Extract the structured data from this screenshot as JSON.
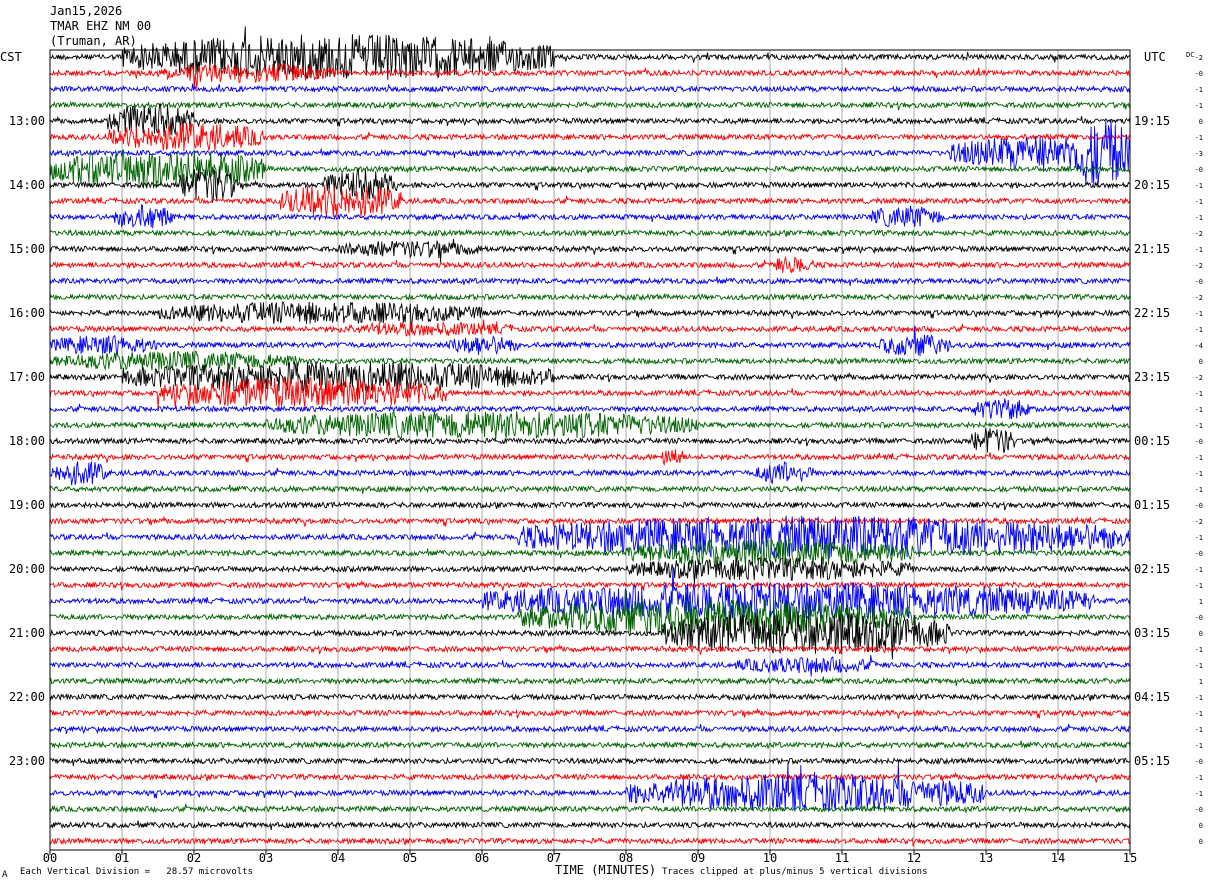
{
  "header": {
    "date": "Jan15,2026",
    "station": "TMAR EHZ NM 00",
    "location": "(Truman, AR)"
  },
  "left_tz": "CST",
  "right_tz": "UTC",
  "dc_label": "DC",
  "footer": {
    "vertical_division": "Each Vertical Division =   28.57 microvolts",
    "xlabel": "TIME (MINUTES)",
    "clip_note": "Traces clipped at plus/minus 5 vertical divisions",
    "corner_mark": "A"
  },
  "colors": {
    "trace_cycle": [
      "#000000",
      "#ff0000",
      "#0000ff",
      "#006400"
    ],
    "grid": "#a9a9a9",
    "frame": "#000000"
  },
  "chart_data": {
    "type": "line",
    "title": "",
    "xlabel": "TIME (MINUTES)",
    "xlim": [
      0,
      15
    ],
    "x_ticks": [
      "00",
      "01",
      "02",
      "03",
      "04",
      "05",
      "06",
      "07",
      "08",
      "09",
      "10",
      "11",
      "12",
      "13",
      "14",
      "15"
    ],
    "rows_per_hour": 4,
    "start_local_hour": "12:00",
    "left_time_labels": [
      "13:00",
      "14:00",
      "15:00",
      "16:00",
      "17:00",
      "18:00",
      "19:00",
      "20:00",
      "21:00",
      "22:00",
      "23:00"
    ],
    "right_time_labels": [
      "19:15",
      "20:15",
      "21:15",
      "22:15",
      "23:15",
      "00:15",
      "01:15",
      "02:15",
      "03:15",
      "04:15",
      "05:15"
    ],
    "dc_offsets": [
      "-2",
      "-0",
      "-1",
      "-1",
      "0",
      "-1",
      "-3",
      "-0",
      "-1",
      "-1",
      "-1",
      "-2",
      "-1",
      "-2",
      "-0",
      "-2",
      "-1",
      "-1",
      "-4",
      "0",
      "-2",
      "-1",
      "-1",
      "-1",
      "-0",
      "-1",
      "-1",
      "-1",
      "-0",
      "-2",
      "-1",
      "-0",
      "-1",
      "-1",
      "1",
      "-0",
      "0",
      "-1",
      "-1",
      "1",
      "-1",
      "-1",
      "-1",
      "-1",
      "-0",
      "-1",
      "-1",
      "-0",
      "0",
      "0"
    ],
    "activity": {
      "description": "helicorder seismogram, each row = 15 minutes",
      "bursts": [
        {
          "row": 0,
          "x_start": 1.0,
          "x_end": 7.0,
          "amp": 1.6
        },
        {
          "row": 1,
          "x_start": 1.5,
          "x_end": 4.0,
          "amp": 0.7
        },
        {
          "row": 4,
          "x_start": 0.8,
          "x_end": 2.0,
          "amp": 1.2
        },
        {
          "row": 5,
          "x_start": 0.8,
          "x_end": 3.0,
          "amp": 1.0
        },
        {
          "row": 6,
          "x_start": 12.5,
          "x_end": 15.0,
          "amp": 1.2
        },
        {
          "row": 6,
          "x_start": 14.2,
          "x_end": 15.0,
          "amp": 2.5
        },
        {
          "row": 7,
          "x_start": 0.0,
          "x_end": 3.0,
          "amp": 1.4
        },
        {
          "row": 8,
          "x_start": 1.8,
          "x_end": 2.6,
          "amp": 1.3
        },
        {
          "row": 8,
          "x_start": 3.8,
          "x_end": 4.8,
          "amp": 1.1
        },
        {
          "row": 9,
          "x_start": 3.2,
          "x_end": 4.9,
          "amp": 1.2
        },
        {
          "row": 10,
          "x_start": 0.9,
          "x_end": 1.7,
          "amp": 0.9
        },
        {
          "row": 10,
          "x_start": 11.4,
          "x_end": 12.4,
          "amp": 0.8
        },
        {
          "row": 12,
          "x_start": 4.0,
          "x_end": 6.0,
          "amp": 0.6
        },
        {
          "row": 13,
          "x_start": 10.0,
          "x_end": 10.6,
          "amp": 0.6
        },
        {
          "row": 16,
          "x_start": 1.5,
          "x_end": 6.0,
          "amp": 0.8
        },
        {
          "row": 17,
          "x_start": 4.0,
          "x_end": 6.5,
          "amp": 0.5
        },
        {
          "row": 18,
          "x_start": 0.0,
          "x_end": 1.5,
          "amp": 0.7
        },
        {
          "row": 18,
          "x_start": 5.5,
          "x_end": 6.5,
          "amp": 0.7
        },
        {
          "row": 18,
          "x_start": 11.5,
          "x_end": 12.5,
          "amp": 0.8
        },
        {
          "row": 19,
          "x_start": 0.0,
          "x_end": 3.5,
          "amp": 0.7
        },
        {
          "row": 20,
          "x_start": 1.0,
          "x_end": 7.0,
          "amp": 1.1
        },
        {
          "row": 21,
          "x_start": 1.5,
          "x_end": 5.5,
          "amp": 1.1
        },
        {
          "row": 22,
          "x_start": 12.8,
          "x_end": 13.6,
          "amp": 0.8
        },
        {
          "row": 23,
          "x_start": 3.0,
          "x_end": 9.0,
          "amp": 1.0
        },
        {
          "row": 24,
          "x_start": 12.8,
          "x_end": 13.4,
          "amp": 1.0
        },
        {
          "row": 25,
          "x_start": 8.5,
          "x_end": 8.8,
          "amp": 0.8
        },
        {
          "row": 26,
          "x_start": 0.0,
          "x_end": 0.8,
          "amp": 0.9
        },
        {
          "row": 26,
          "x_start": 9.8,
          "x_end": 10.6,
          "amp": 0.8
        },
        {
          "row": 30,
          "x_start": 6.5,
          "x_end": 15.0,
          "amp": 1.5
        },
        {
          "row": 31,
          "x_start": 8.0,
          "x_end": 12.0,
          "amp": 1.0
        },
        {
          "row": 32,
          "x_start": 8.0,
          "x_end": 12.0,
          "amp": 0.8
        },
        {
          "row": 34,
          "x_start": 6.0,
          "x_end": 14.5,
          "amp": 1.3
        },
        {
          "row": 35,
          "x_start": 6.5,
          "x_end": 12.0,
          "amp": 1.3
        },
        {
          "row": 36,
          "x_start": 8.5,
          "x_end": 12.5,
          "amp": 1.5
        },
        {
          "row": 38,
          "x_start": 9.5,
          "x_end": 11.5,
          "amp": 0.6
        },
        {
          "row": 46,
          "x_start": 8.0,
          "x_end": 13.0,
          "amp": 1.3
        }
      ]
    }
  }
}
